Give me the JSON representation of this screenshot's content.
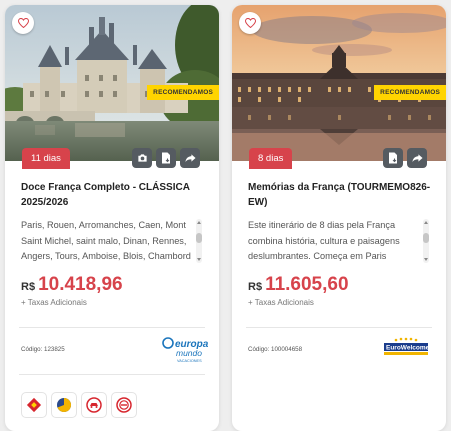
{
  "cards": [
    {
      "ribbon": "RECOMENDAMOS",
      "days": "11 dias",
      "title": "Doce França Completo - CLÁSSICA 2025/2026",
      "description": "Paris, Rouen, Arromanches, Caen, Mont Saint Michel, saint malo, Dinan, Rennes, Angers, Tours, Amboise, Blois, Chambord",
      "currency": "R$",
      "price": "10.418,96",
      "taxes": "+ Taxas Adicionais",
      "code": "Código: 123825",
      "operator_logo": {
        "line1": "europa",
        "line2": "mundo",
        "line3": "VACACIONES"
      },
      "actions": [
        "camera-icon",
        "document-download-icon",
        "share-icon"
      ],
      "badges": [
        "red-diamond-badge-icon",
        "yellow-pie-badge-icon",
        "red-car-badge-icon",
        "red-circle-seal-badge-icon"
      ]
    },
    {
      "ribbon": "RECOMENDAMOS",
      "days": "8 dias",
      "title": "Memórias da França (TOURMEMO826-EW)",
      "description": "Este itinerário de 8 dias pela França combina história, cultura e paisagens deslumbrantes. Começa em Paris",
      "currency": "R$",
      "price": "11.605,60",
      "taxes": "+ Taxas Adicionais",
      "code": "Código: 100004658",
      "operator_logo": {
        "line1": "EuroWelcome",
        "line2": ""
      },
      "actions": [
        "document-download-icon",
        "share-icon"
      ]
    }
  ],
  "colors": {
    "accent": "#d7434b",
    "ribbon": "#ffd400",
    "action_button": "#555b61"
  }
}
